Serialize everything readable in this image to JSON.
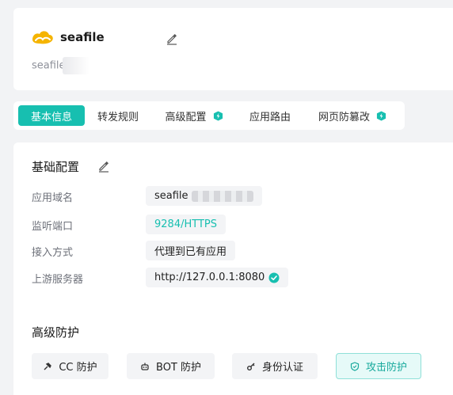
{
  "app": {
    "name": "seafile",
    "subtitle": "seafile"
  },
  "tabs": [
    {
      "label": "基本信息",
      "active": true
    },
    {
      "label": "转发规则",
      "active": false
    },
    {
      "label": "高级配置",
      "active": false,
      "badge": true
    },
    {
      "label": "应用路由",
      "active": false
    },
    {
      "label": "网页防篡改",
      "active": false,
      "badge": true
    }
  ],
  "basic": {
    "title": "基础配置",
    "domain_label": "应用域名",
    "domain_value": "seafile",
    "port_label": "监听端口",
    "port_value": "9284/HTTPS",
    "access_label": "接入方式",
    "access_value": "代理到已有应用",
    "upstream_label": "上游服务器",
    "upstream_value": "http://127.0.0.1:8080"
  },
  "protection": {
    "title": "高级防护",
    "cc": "CC 防护",
    "bot": "BOT 防护",
    "auth": "身份认证",
    "attack": "攻击防护"
  },
  "colors": {
    "accent": "#17bfb0",
    "logo": "#f5b400"
  }
}
